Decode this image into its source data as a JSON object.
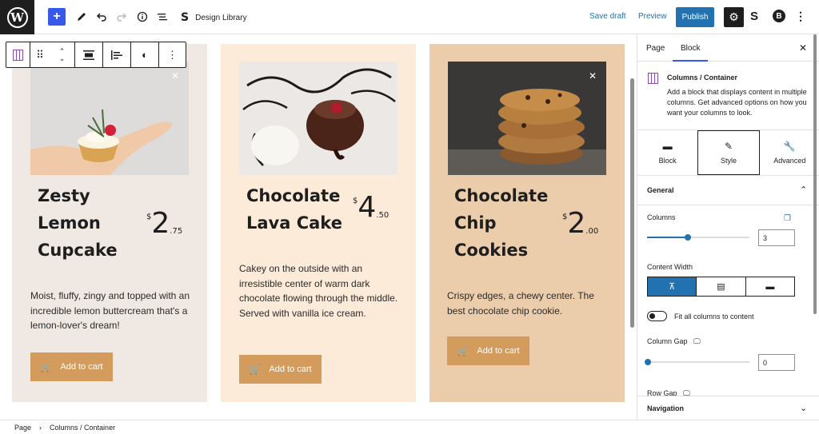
{
  "topbar": {
    "add_icon": "+",
    "doc_title": "Design Library",
    "doc_logo": "S",
    "save_draft": "Save draft",
    "preview": "Preview",
    "publish": "Publish",
    "settings_icon": "⚙",
    "plugin1": "S",
    "plugin2": "B",
    "more": "⋮"
  },
  "block_toolbar": {
    "drag_icon": "⠿",
    "move_icon": "⌃⌄",
    "align_icon": "≡",
    "justify_icon": "☰",
    "style_icon": "◐",
    "more_icon": "⋮"
  },
  "cards": [
    {
      "title_lines": [
        "Zesty",
        "Lemon",
        "Cupcake"
      ],
      "currency": "$",
      "price_main": "2",
      "price_cents": ".75",
      "description": "Moist, fluffy, zingy and topped with an incredible lemon buttercream that's a lemon-lover's dream!",
      "button": "Add to cart",
      "bg": "#f0e9e3"
    },
    {
      "title_lines": [
        "Chocolate",
        "Lava Cake"
      ],
      "currency": "$",
      "price_main": "4",
      "price_cents": ".50",
      "description": "Cakey on the outside with an irresistible center of warm dark chocolate flowing through the middle. Served with vanilla ice cream.",
      "button": "Add to cart",
      "bg": "#fdebd9"
    },
    {
      "title_lines": [
        "Chocolate",
        "Chip",
        "Cookies"
      ],
      "currency": "$",
      "price_main": "2",
      "price_cents": ".00",
      "description": "Crispy edges, a chewy center. The best chocolate chip cookie.",
      "button": "Add to cart",
      "bg": "#eccdab"
    }
  ],
  "sidebar": {
    "tab_page": "Page",
    "tab_block": "Block",
    "close": "✕",
    "block_title": "Columns / Container",
    "block_desc": "Add a block that displays content in multiple columns. Get advanced options on how you want your columns to look.",
    "modes": [
      "Block",
      "Style",
      "Advanced"
    ],
    "general": "General",
    "columns_label": "Columns",
    "columns_value": "3",
    "columns_fraction": 0.4,
    "content_width_label": "Content Width",
    "fit_label": "Fit all columns to content",
    "gap_label": "Column Gap",
    "gap_value": "0",
    "row_gap_label": "Row Gap",
    "navigation": "Navigation"
  },
  "footer": {
    "crumb1": "Page",
    "sep": "›",
    "crumb2": "Columns / Container"
  },
  "colors": {
    "accent": "#2271b1",
    "button": "#d39c5c",
    "wp_blue": "#3858e9",
    "columns_icon": "#8a4baf"
  }
}
